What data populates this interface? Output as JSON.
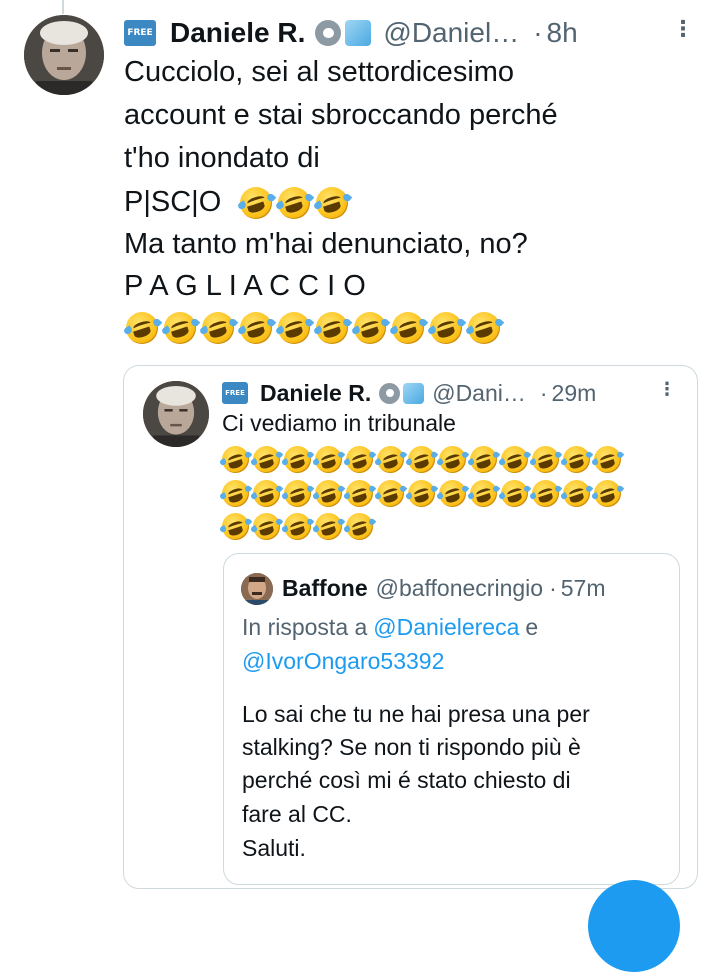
{
  "main_tweet": {
    "badge": "FREE",
    "author_name": "Daniele R.",
    "handle": "@Daniel…",
    "separator": "·",
    "time": "8h",
    "lines": [
      "Cucciolo, sei al settordicesimo",
      "account e stai sbroccando perché",
      "t'ho inondato di",
      "P|SC|O",
      "Ma tanto m'hai denunciato, no?",
      "P A G L I A C C I O"
    ]
  },
  "quoted_tweet": {
    "badge": "FREE",
    "author_name": "Daniele R.",
    "handle": "@Dani…",
    "separator": "·",
    "time": "29m",
    "text": "Ci vediamo in tribunale"
  },
  "inner_quote": {
    "author_name": "Baffone",
    "handle": "@baffonecringio",
    "separator": "·",
    "time": "57m",
    "reply_prefix": "In risposta a",
    "reply_user_1": "@Danielereca",
    "reply_and": "e",
    "reply_user_2": "@IvorOngaro53392",
    "lines": [
      "Lo sai che tu ne hai presa una per",
      "stalking? Se non ti rispondo più è",
      "perché così mi é stato chiesto di",
      "fare al CC.",
      "Saluti."
    ]
  },
  "icons": {
    "laugh": "rolling-on-the-floor-laughing-emoji",
    "verified": "verified-badge-icon",
    "gear": "automated-gear-icon",
    "more": "more-options-icon"
  },
  "colors": {
    "text": "#0f1419",
    "secondary": "#536471",
    "link": "#1d9bf0",
    "border": "#cfd9de",
    "badge": "#3b88c3"
  }
}
